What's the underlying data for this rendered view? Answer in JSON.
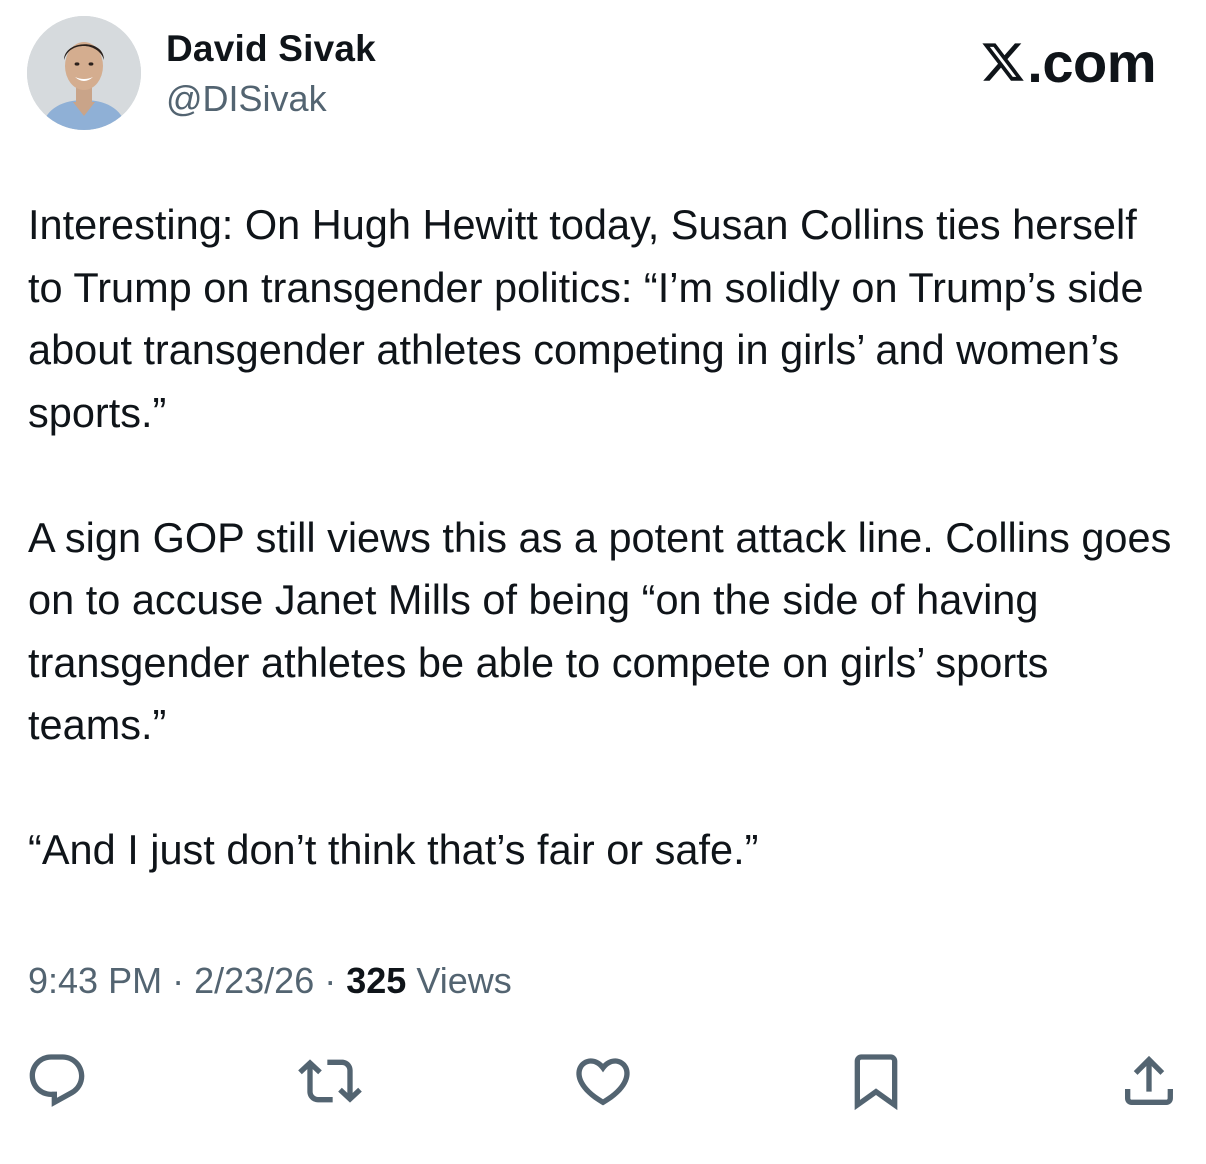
{
  "author": {
    "display_name": "David Sivak",
    "handle": "@DISivak"
  },
  "brand": {
    "label": ".com",
    "icon": "x-logo-icon"
  },
  "tweet": {
    "paragraphs": [
      "Interesting: On Hugh Hewitt today, Susan Collins ties herself to Trump on transgender politics: “I’m solidly on Trump’s side about transgender athletes competing in girls’ and women’s sports.”",
      "A sign GOP still views this as a potent attack line. Collins goes on to accuse Janet Mills of being “on the side of having transgender athletes be able to compete on girls’ sports teams.”",
      "“And I just don’t think that’s fair or safe.”"
    ],
    "time": "9:43 PM",
    "separator": "·",
    "date": "2/23/26",
    "views_count": "325",
    "views_label": "Views"
  },
  "actions": [
    {
      "name": "reply",
      "icon": "reply-icon"
    },
    {
      "name": "repost",
      "icon": "repost-icon"
    },
    {
      "name": "like",
      "icon": "heart-icon"
    },
    {
      "name": "bookmark",
      "icon": "bookmark-icon"
    },
    {
      "name": "share",
      "icon": "share-icon"
    }
  ],
  "colors": {
    "text": "#0f1419",
    "secondary": "#536471",
    "background": "#ffffff"
  }
}
